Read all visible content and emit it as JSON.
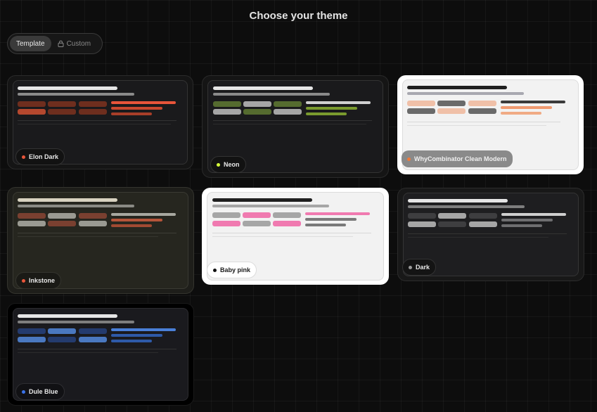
{
  "header": {
    "title": "Choose your theme"
  },
  "tabs": [
    {
      "label": "Template",
      "active": true
    },
    {
      "label": "Custom",
      "active": false,
      "icon": "lock-icon"
    }
  ],
  "themes": [
    {
      "name": "Elon Dark",
      "dot": "#e8553a",
      "selected": false
    },
    {
      "name": "Neon",
      "dot": "#d6ff3a",
      "selected": false
    },
    {
      "name": "WhyCombinator Clean Modern",
      "dot": "#f07a3a",
      "selected": true
    },
    {
      "name": "Inkstone",
      "dot": "#e8553a",
      "selected": false
    },
    {
      "name": "Baby pink",
      "dot": "#111111",
      "selected": true
    },
    {
      "name": "Dark",
      "dot": "#9a9a9a",
      "selected": false
    },
    {
      "name": "Dule Blue",
      "dot": "#3a72e8",
      "selected": false
    }
  ]
}
